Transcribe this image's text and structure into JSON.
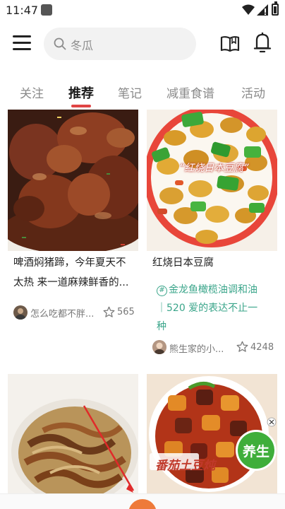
{
  "status_bar": {
    "time": "11:47"
  },
  "header": {
    "search_placeholder": "冬瓜"
  },
  "tabs": [
    {
      "label": "关注"
    },
    {
      "label": "推荐"
    },
    {
      "label": "笔记"
    },
    {
      "label": "减重食谱"
    },
    {
      "label": "活动"
    }
  ],
  "active_tab": "推荐",
  "feed": [
    {
      "title_line1": "啤酒焖猪蹄，今年夏天不",
      "title_line2": "太热 来一道麻辣鲜香的...",
      "author": "怎么吃都不胖...",
      "likes": "565"
    },
    {
      "title": "红烧日本豆腐",
      "image_caption": "红烧日本豆腐",
      "ad_line1": "金龙鱼橄榄油调和油",
      "ad_line2": "｜520 爱的表达不止一",
      "ad_line3": "种",
      "author": "熊生家的小...",
      "likes": "4248"
    },
    {
      "image_caption": "番茄土豆炖",
      "badge": "养生"
    }
  ],
  "colors": {
    "accent_red": "#e04444",
    "ad_green": "#3aa58a",
    "badge_green": "#3fae3a",
    "fab_orange": "#ee7a3a"
  }
}
